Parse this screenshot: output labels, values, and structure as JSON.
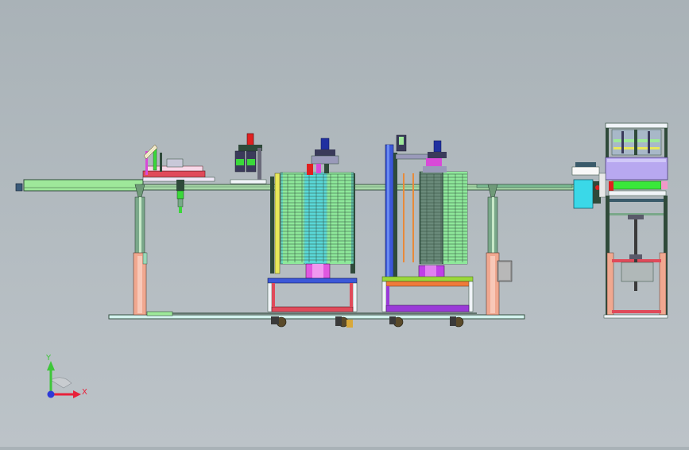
{
  "view": {
    "background": "#b2babf"
  },
  "triad": {
    "x_label": "X",
    "y_label": "Y",
    "x_color": "#e8213a",
    "y_color": "#3ec63a",
    "z_color": "#2e3ad8"
  },
  "colors": {
    "frame": "#2f4a3a",
    "conveyor": "#9ee89a",
    "rail": "#6f9a78",
    "leg": "#f0a890",
    "base_plate": "#d4f2ee",
    "cart_blue": "#3c58d8",
    "cart_red": "#e04a5a",
    "cart_purple": "#9a3ad8",
    "cart_orange": "#f07a3a",
    "stack_green": "#8ee89a",
    "stack_cyan": "#5ad8d8",
    "magenta": "#d84ad8",
    "cyan_box": "#3ad8e8",
    "lavender": "#b8a8f0",
    "yellow": "#e8e85a",
    "red": "#e02020",
    "dark_blue": "#2030a0"
  }
}
